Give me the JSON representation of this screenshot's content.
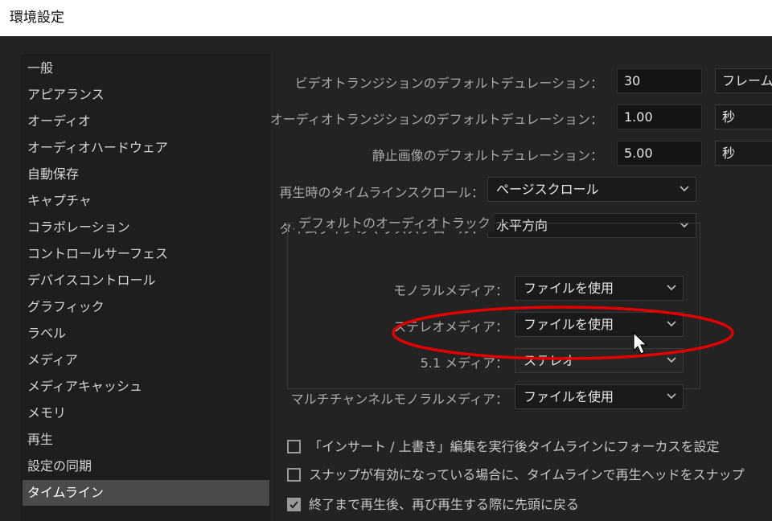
{
  "window": {
    "title": "環境設定"
  },
  "sidebar": {
    "items": [
      {
        "label": "一般"
      },
      {
        "label": "アピアランス"
      },
      {
        "label": "オーディオ"
      },
      {
        "label": "オーディオハードウェア"
      },
      {
        "label": "自動保存"
      },
      {
        "label": "キャプチャ"
      },
      {
        "label": "コラボレーション"
      },
      {
        "label": "コントロールサーフェス"
      },
      {
        "label": "デバイスコントロール"
      },
      {
        "label": "グラフィック"
      },
      {
        "label": "ラベル"
      },
      {
        "label": "メディア"
      },
      {
        "label": "メディアキャッシュ"
      },
      {
        "label": "メモリ"
      },
      {
        "label": "再生"
      },
      {
        "label": "設定の同期"
      },
      {
        "label": "タイムライン"
      }
    ],
    "selected": "タイムライン"
  },
  "timeline": {
    "video_transition": {
      "label": "ビデオトランジションのデフォルトデュレーション：",
      "value": "30",
      "unit": "フレーム"
    },
    "audio_transition": {
      "label": "オーディオトランジションのデフォルトデュレーション：",
      "value": "1.00",
      "unit": "秒"
    },
    "still_image": {
      "label": "静止画像のデフォルトデュレーション：",
      "value": "5.00",
      "unit": "秒"
    },
    "playback_scroll": {
      "label": "再生時のタイムラインスクロール：",
      "value": "ページスクロール"
    },
    "mouse_scroll": {
      "label": "タイムラインのマウススクロール：",
      "value": "水平方向"
    },
    "default_audio_tracks": {
      "title": "デフォルトのオーディオトラック",
      "mono": {
        "label": "モノラルメディア：",
        "value": "ファイルを使用"
      },
      "stereo": {
        "label": "ステレオメディア：",
        "value": "ファイルを使用"
      },
      "five_one": {
        "label": "5.1 メディア：",
        "value": "ステレオ"
      },
      "multichannel": {
        "label": "マルチチャンネルモノラルメディア：",
        "value": "ファイルを使用"
      }
    },
    "checkboxes": [
      {
        "label": "「インサート / 上書き」編集を実行後タイムラインにフォーカスを設定",
        "checked": false
      },
      {
        "label": "スナップが有効になっている場合に、タイムラインで再生ヘッドをスナップ",
        "checked": false
      },
      {
        "label": "終了まで再生後、再び再生する際に先頭に戻る",
        "checked": true
      }
    ]
  },
  "colors": {
    "annotation": "#e00000",
    "selected_bg": "#4a4a4a"
  }
}
